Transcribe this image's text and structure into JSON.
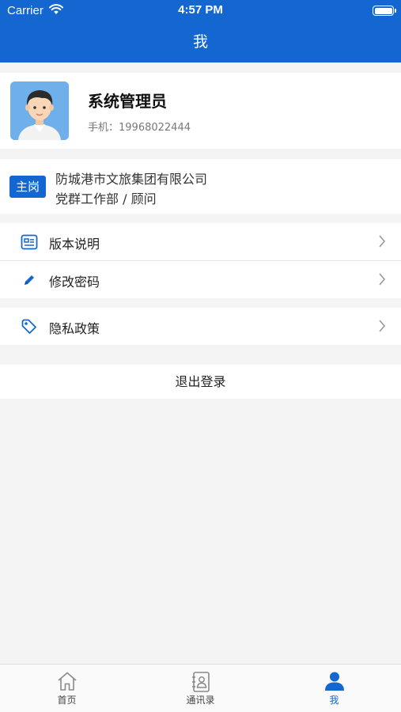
{
  "status_bar": {
    "carrier": "Carrier",
    "time": "4:57 PM"
  },
  "nav": {
    "title": "我"
  },
  "profile": {
    "name": "系统管理员",
    "phone_label": "手机：",
    "phone": "19968022444"
  },
  "post": {
    "badge": "主岗",
    "company": "防城港市文旅集团有限公司",
    "department": "党群工作部 / 顾问"
  },
  "menu": {
    "version": "版本说明",
    "password": "修改密码",
    "privacy": "隐私政策"
  },
  "logout_label": "退出登录",
  "tabbar": {
    "tabs": [
      {
        "label": "首页",
        "icon": "home-icon"
      },
      {
        "label": "通讯录",
        "icon": "contacts-icon"
      },
      {
        "label": "我",
        "icon": "person-icon"
      }
    ],
    "active": "我"
  },
  "colors": {
    "primary": "#1467d1",
    "background": "#f4f4f5"
  }
}
